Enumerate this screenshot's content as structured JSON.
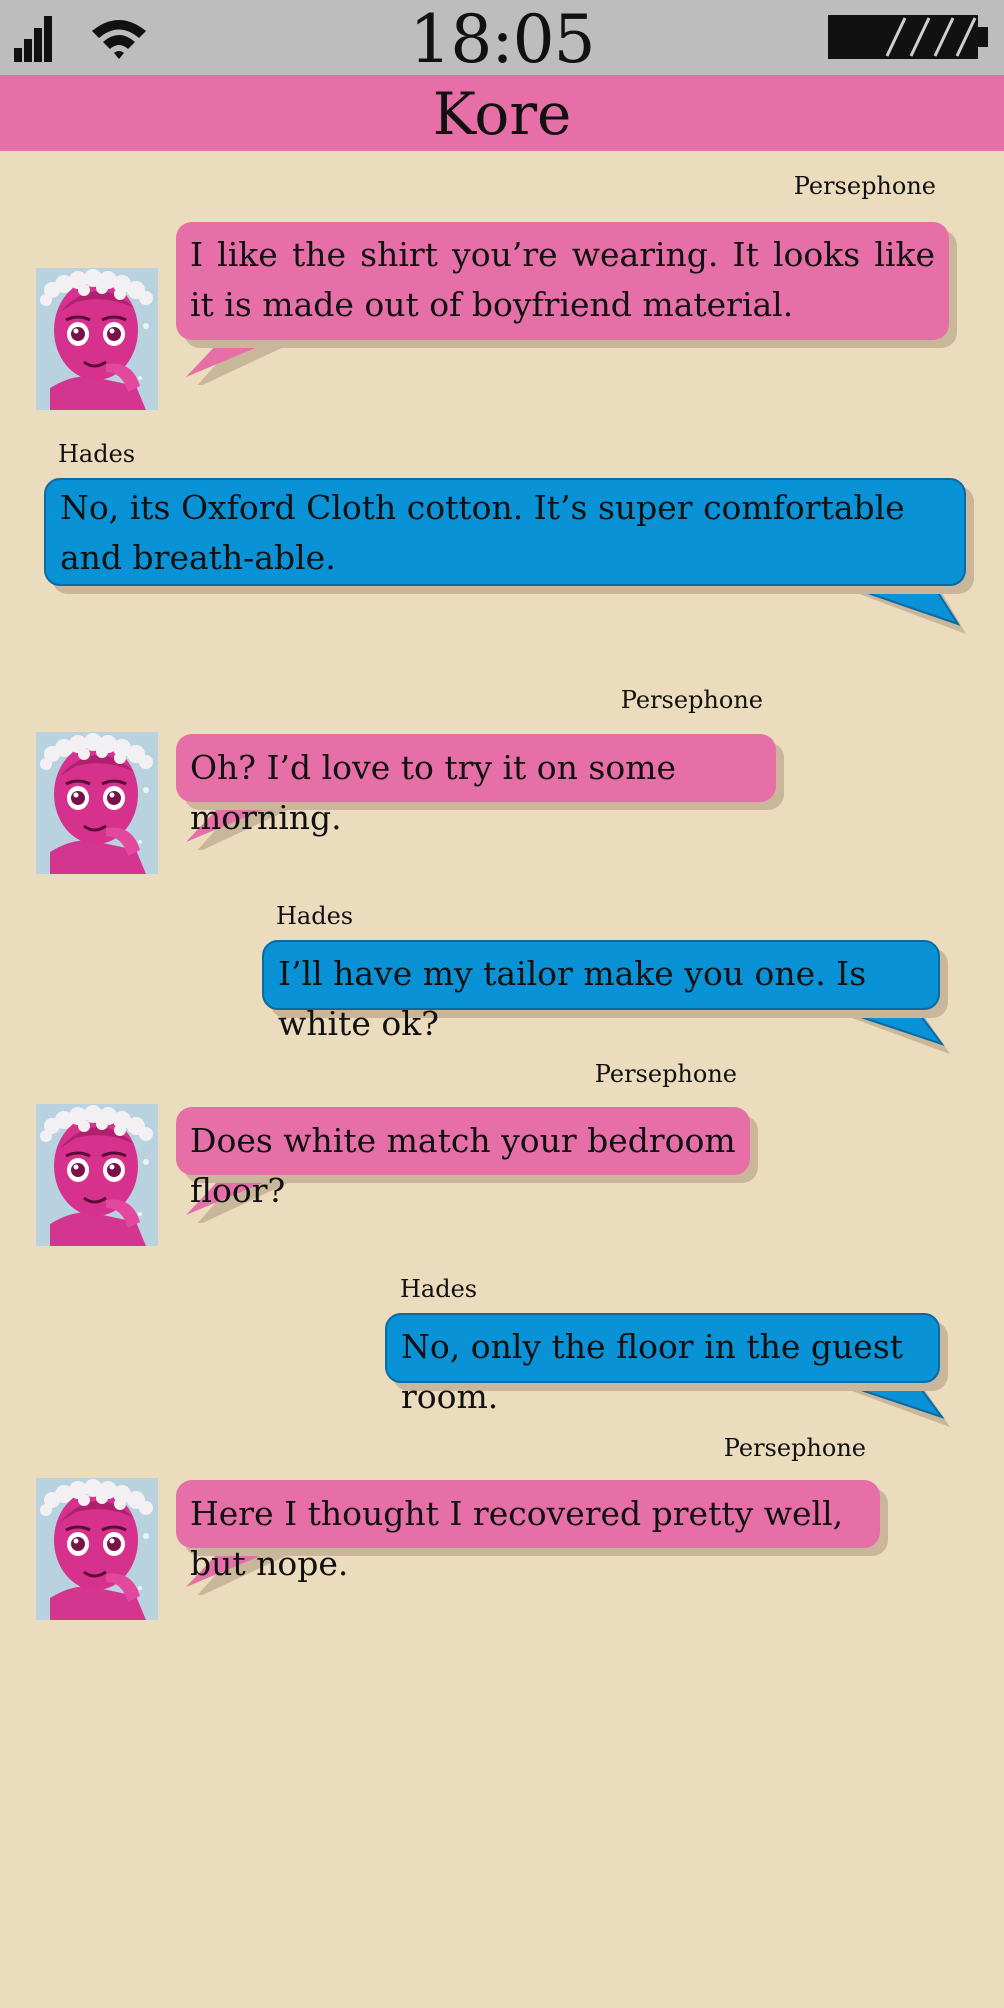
{
  "status_bar": {
    "time": "18:05"
  },
  "chat": {
    "title": "Kore"
  },
  "messages": [
    {
      "sender": "Persephone",
      "text": "I like the shirt you’re wearing. It looks like it is made out of boyfriend material.",
      "side": "left"
    },
    {
      "sender": "Hades",
      "text": "No, its Oxford Cloth cotton. It’s super comfortable and breath-able.",
      "side": "right"
    },
    {
      "sender": "Persephone",
      "text": "Oh? I’d love to try it on some morning.",
      "side": "left"
    },
    {
      "sender": "Hades",
      "text": "I’ll have my tailor make you one. Is white ok?",
      "side": "right"
    },
    {
      "sender": "Persephone",
      "text": "Does white match your bedroom floor?",
      "side": "left"
    },
    {
      "sender": "Hades",
      "text": "No, only the floor in the guest room.",
      "side": "right"
    },
    {
      "sender": "Persephone",
      "text": "Here I thought I recovered pretty well, but nope.",
      "side": "left"
    }
  ],
  "colors": {
    "background": "#ebdcbd",
    "status_bar": "#bdbdbd",
    "title_bar": "#e66fa7",
    "persephone_bubble": "#e66fa7",
    "hades_bubble": "#0992d6"
  },
  "icons": {
    "signal": "signal-bars-icon",
    "wifi": "wifi-icon",
    "battery": "battery-icon",
    "avatar": "persephone-avatar"
  }
}
